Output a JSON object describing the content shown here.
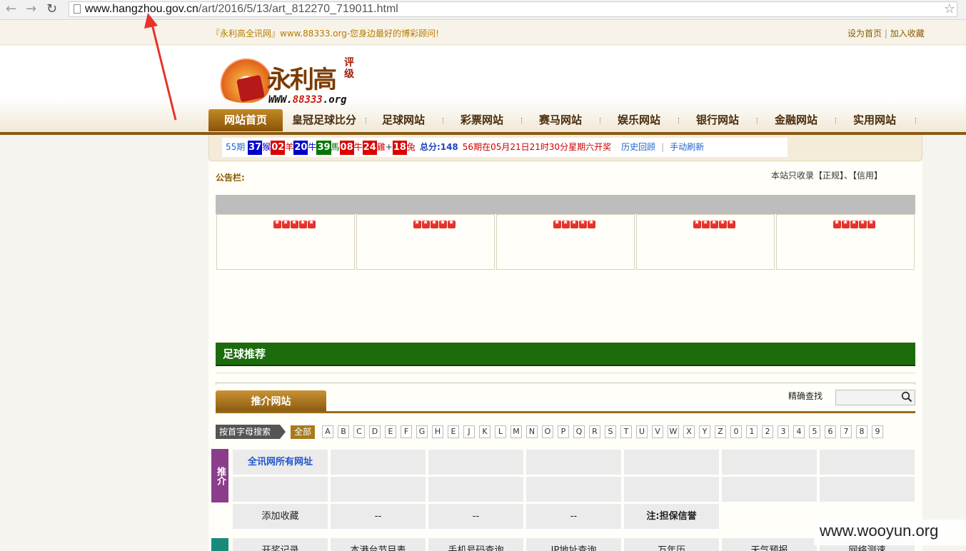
{
  "browser": {
    "url_host": "www.hangzhou.gov.cn",
    "url_path": "/art/2016/5/13/art_812270_719011.html"
  },
  "topbar": {
    "slogan": "『永利高全讯网』",
    "slogan_url": "www.88333.org",
    "slogan_tail": "-您身边最好的博彩顾问!",
    "set_home": "设为首页",
    "sep": "|",
    "add_fav": "加入收藏"
  },
  "logo": {
    "name": "永利高",
    "badge": "评级",
    "url_prefix": "WWW.",
    "url_mid": "88333",
    "url_suffix": ".org"
  },
  "nav": {
    "items": [
      "网站首页",
      "皇冠足球比分",
      "足球网站",
      "彩票网站",
      "赛马网站",
      "娱乐网站",
      "银行网站",
      "金融网站",
      "实用网站"
    ]
  },
  "lottery": {
    "issue": "55期",
    "balls": [
      {
        "num": "37",
        "zodiac": "猴",
        "color": "blue"
      },
      {
        "num": "02",
        "zodiac": "羊",
        "color": "red"
      },
      {
        "num": "20",
        "zodiac": "牛",
        "color": "blue"
      },
      {
        "num": "39",
        "zodiac": "馬",
        "color": "green"
      },
      {
        "num": "08",
        "zodiac": "牛",
        "color": "red"
      },
      {
        "num": "24",
        "zodiac": "雞",
        "color": "red"
      }
    ],
    "plus": "+",
    "special": {
      "num": "18",
      "zodiac": "兔",
      "color": "red"
    },
    "total": "总分:148",
    "next": "56期在05月21日21时30分星期六开奖",
    "history": "历史回顾",
    "refresh": "手动刷新",
    "divider": "|"
  },
  "notice": {
    "label": "公告栏:",
    "right_text": "本站只收录【正规】、【信用】"
  },
  "rating_cards": 5,
  "football": {
    "heading": "足球推荐"
  },
  "recommend": {
    "tab": "推介网站",
    "search_label": "精确查找",
    "search_value": ""
  },
  "alphabet": {
    "label": "按首字母搜索",
    "all": "全部",
    "letters": [
      "A",
      "B",
      "C",
      "D",
      "E",
      "F",
      "G",
      "H",
      "E",
      "J",
      "K",
      "L",
      "M",
      "N",
      "O",
      "P",
      "Q",
      "R",
      "S",
      "T",
      "U",
      "V",
      "W",
      "X",
      "Y",
      "Z",
      "0",
      "1",
      "2",
      "3",
      "4",
      "5",
      "6",
      "7",
      "8",
      "9"
    ]
  },
  "grid": {
    "side_tag": "推介",
    "row1_first": "全讯网所有网址",
    "row3": [
      "添加收藏",
      "--",
      "--",
      "--",
      "注:担保信誉"
    ],
    "row4": [
      "开奖记录",
      "本港台节目表",
      "手机号码查询",
      "IP地址查询",
      "万年历",
      "天气预报",
      "网络测速"
    ]
  },
  "watermark": "www.wooyun.org",
  "colors": {
    "brand_brown": "#8a5a12",
    "nav_active": "#a8701a",
    "section_green": "#1c6b0c",
    "side_purple": "#8a3d8a",
    "annotation_arrow": "#e8332b"
  }
}
